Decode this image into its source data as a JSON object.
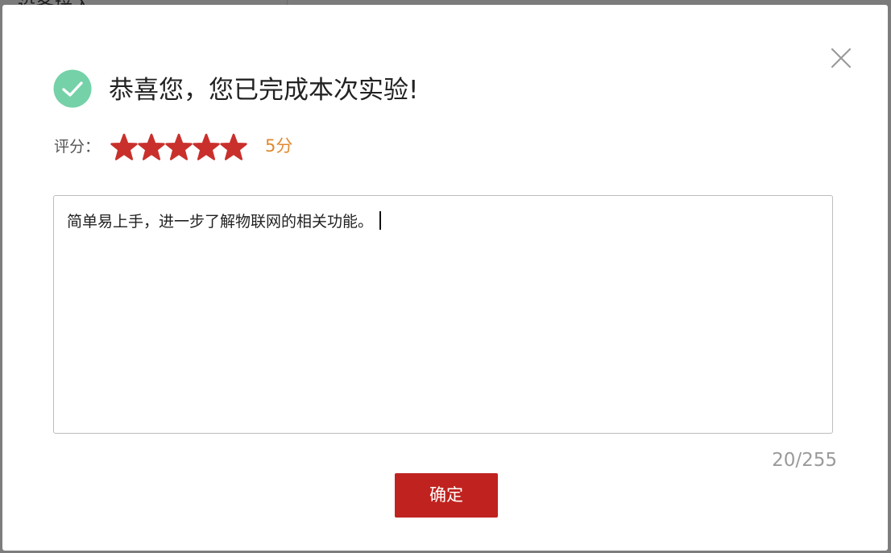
{
  "backdrop": {
    "heading_fragment": "设备接入"
  },
  "dialog": {
    "title": "恭喜您，您已完成本次实验!",
    "rating_label": "评分：",
    "rating": {
      "value": 5,
      "max": 5,
      "color": "#c9302c",
      "score_text": "5分"
    },
    "comment": {
      "value": "简单易上手，进一步了解物联网的相关功能。",
      "counter": "20/255"
    },
    "confirm_label": "确定"
  },
  "icons": {
    "success": "check-circle-icon",
    "close": "close-icon",
    "star": "star-icon"
  },
  "colors": {
    "success_green": "#74d1a8",
    "accent_red": "#c0231f",
    "score_orange": "#e08a2f"
  }
}
